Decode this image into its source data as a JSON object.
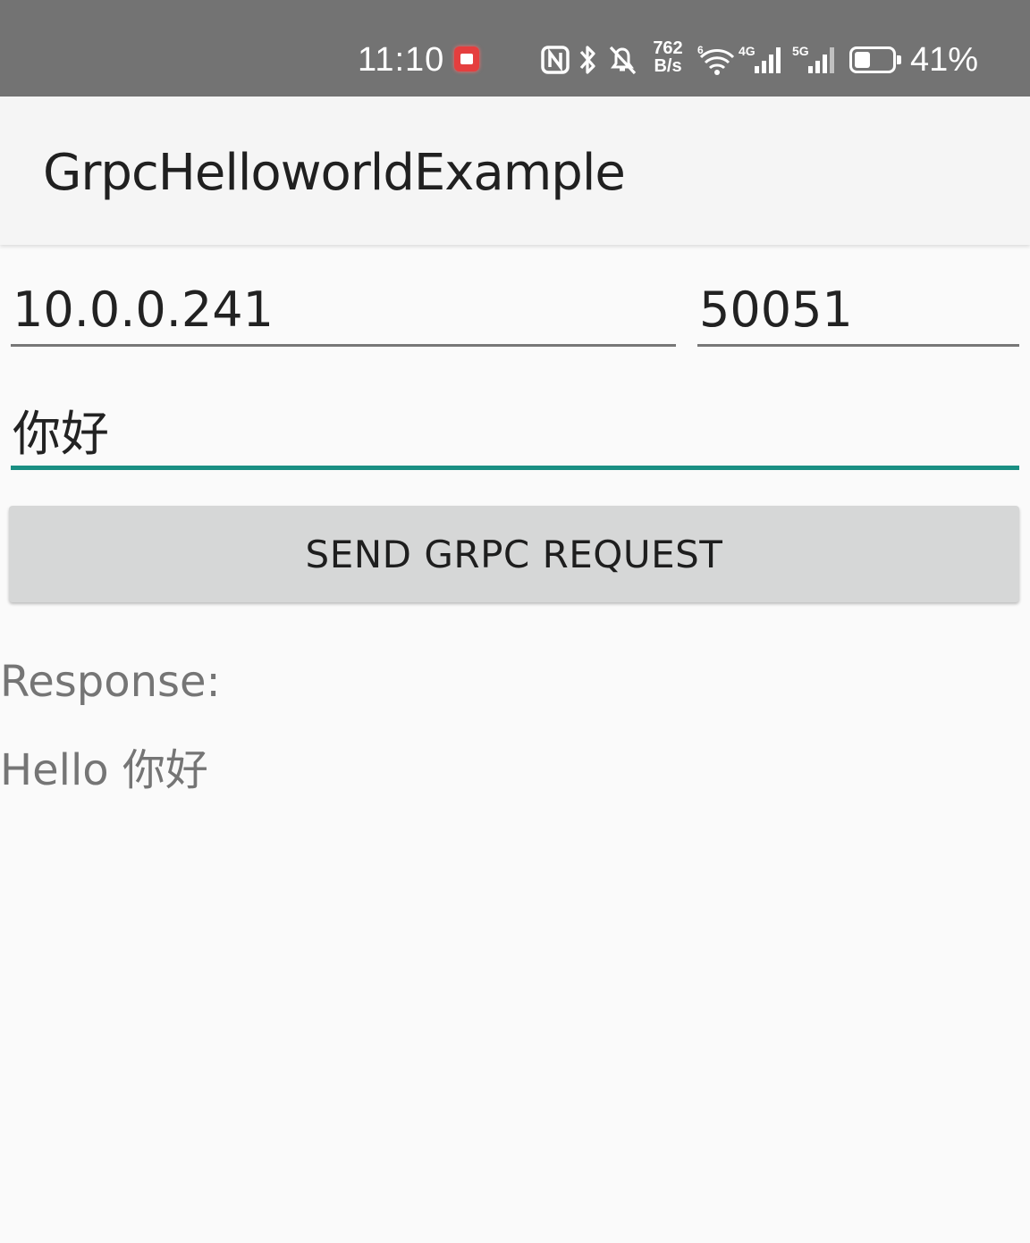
{
  "status_bar": {
    "time": "11:10",
    "net_speed_value": "762",
    "net_speed_unit": "B/s",
    "battery_percent": "41%",
    "icons": [
      "app-notification-icon",
      "nfc-icon",
      "bluetooth-icon",
      "bell-muted-icon",
      "wifi-icon",
      "signal-4g-icon",
      "signal-5g-icon",
      "battery-icon"
    ]
  },
  "app_bar": {
    "title": "GrpcHelloworldExample"
  },
  "form": {
    "host_value": "10.0.0.241",
    "port_value": "50051",
    "message_value": "你好",
    "send_label": "SEND GRPC REQUEST"
  },
  "response": {
    "label": "Response:",
    "text": "Hello 你好"
  },
  "colors": {
    "status_bar_bg": "#737373",
    "app_bar_bg": "#f5f5f5",
    "accent": "#1a8f83",
    "button_bg": "#d6d7d7"
  }
}
